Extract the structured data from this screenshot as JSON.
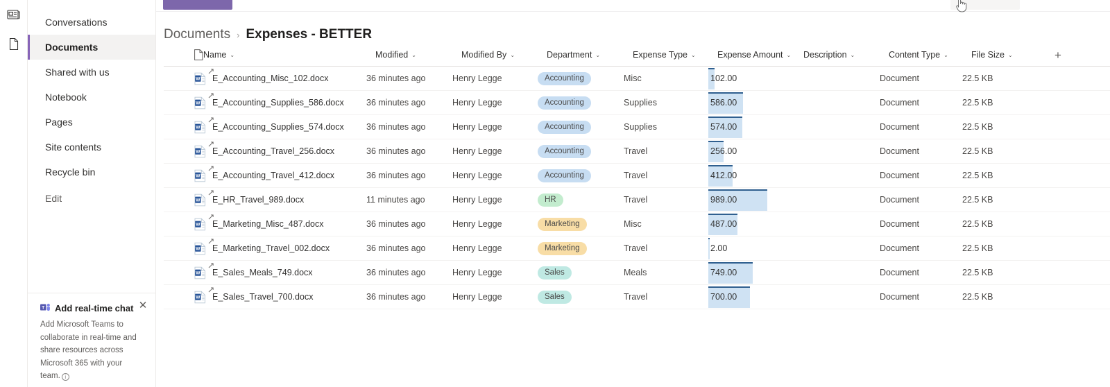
{
  "rail": {
    "icons": [
      {
        "name": "news-icon",
        "glyph": "news"
      },
      {
        "name": "document-icon",
        "glyph": "page"
      }
    ]
  },
  "sidebar": {
    "items": [
      {
        "label": "Conversations",
        "selected": false
      },
      {
        "label": "Documents",
        "selected": true
      },
      {
        "label": "Shared with us",
        "selected": false
      },
      {
        "label": "Notebook",
        "selected": false
      },
      {
        "label": "Pages",
        "selected": false
      },
      {
        "label": "Site contents",
        "selected": false
      },
      {
        "label": "Recycle bin",
        "selected": false
      }
    ],
    "edit_label": "Edit",
    "accent_color": "#8764b8"
  },
  "promo": {
    "title": "Add real-time chat",
    "body": "Add Microsoft Teams to collaborate in real-time and share resources across Microsoft 365 with your team.",
    "close_label": "✕",
    "info_label": "i"
  },
  "breadcrumb": {
    "root": "Documents",
    "separator": "›",
    "leaf": "Expenses - BETTER"
  },
  "table": {
    "columns": [
      {
        "key": "name",
        "label": "Name"
      },
      {
        "key": "mod",
        "label": "Modified"
      },
      {
        "key": "modby",
        "label": "Modified By"
      },
      {
        "key": "dept",
        "label": "Department"
      },
      {
        "key": "etype",
        "label": "Expense Type"
      },
      {
        "key": "amt",
        "label": "Expense Amount"
      },
      {
        "key": "desc",
        "label": "Description"
      },
      {
        "key": "ctype",
        "label": "Content Type"
      },
      {
        "key": "size",
        "label": "File Size"
      }
    ],
    "add_column_label": "+",
    "sort_chevron": "⌄",
    "amount_max": 989,
    "bar_fill": "#cfe2f3",
    "bar_border": "#2f5f8f",
    "dept_colors": {
      "Accounting": "#c7ddf2",
      "HR": "#c3ecce",
      "Marketing": "#f8dda6",
      "Sales": "#bfe9e3"
    },
    "rows": [
      {
        "name": "E_Accounting_Misc_102.docx",
        "mod": "36 minutes ago",
        "modby": "Henry Legge",
        "dept": "Accounting",
        "etype": "Misc",
        "amt": "102.00",
        "amt_value": 102,
        "desc": "",
        "ctype": "Document",
        "size": "22.5 KB"
      },
      {
        "name": "E_Accounting_Supplies_586.docx",
        "mod": "36 minutes ago",
        "modby": "Henry Legge",
        "dept": "Accounting",
        "etype": "Supplies",
        "amt": "586.00",
        "amt_value": 586,
        "desc": "",
        "ctype": "Document",
        "size": "22.5 KB"
      },
      {
        "name": "E_Accounting_Supplies_574.docx",
        "mod": "36 minutes ago",
        "modby": "Henry Legge",
        "dept": "Accounting",
        "etype": "Supplies",
        "amt": "574.00",
        "amt_value": 574,
        "desc": "",
        "ctype": "Document",
        "size": "22.5 KB"
      },
      {
        "name": "E_Accounting_Travel_256.docx",
        "mod": "36 minutes ago",
        "modby": "Henry Legge",
        "dept": "Accounting",
        "etype": "Travel",
        "amt": "256.00",
        "amt_value": 256,
        "desc": "",
        "ctype": "Document",
        "size": "22.5 KB"
      },
      {
        "name": "E_Accounting_Travel_412.docx",
        "mod": "36 minutes ago",
        "modby": "Henry Legge",
        "dept": "Accounting",
        "etype": "Travel",
        "amt": "412.00",
        "amt_value": 412,
        "desc": "",
        "ctype": "Document",
        "size": "22.5 KB"
      },
      {
        "name": "E_HR_Travel_989.docx",
        "mod": "11 minutes ago",
        "modby": "Henry Legge",
        "dept": "HR",
        "etype": "Travel",
        "amt": "989.00",
        "amt_value": 989,
        "desc": "",
        "ctype": "Document",
        "size": "22.5 KB"
      },
      {
        "name": "E_Marketing_Misc_487.docx",
        "mod": "36 minutes ago",
        "modby": "Henry Legge",
        "dept": "Marketing",
        "etype": "Misc",
        "amt": "487.00",
        "amt_value": 487,
        "desc": "",
        "ctype": "Document",
        "size": "22.5 KB"
      },
      {
        "name": "E_Marketing_Travel_002.docx",
        "mod": "36 minutes ago",
        "modby": "Henry Legge",
        "dept": "Marketing",
        "etype": "Travel",
        "amt": "2.00",
        "amt_value": 2,
        "desc": "",
        "ctype": "Document",
        "size": "22.5 KB"
      },
      {
        "name": "E_Sales_Meals_749.docx",
        "mod": "36 minutes ago",
        "modby": "Henry Legge",
        "dept": "Sales",
        "etype": "Meals",
        "amt": "749.00",
        "amt_value": 749,
        "desc": "",
        "ctype": "Document",
        "size": "22.5 KB"
      },
      {
        "name": "E_Sales_Travel_700.docx",
        "mod": "36 minutes ago",
        "modby": "Henry Legge",
        "dept": "Sales",
        "etype": "Travel",
        "amt": "700.00",
        "amt_value": 700,
        "desc": "",
        "ctype": "Document",
        "size": "22.5 KB"
      }
    ]
  }
}
